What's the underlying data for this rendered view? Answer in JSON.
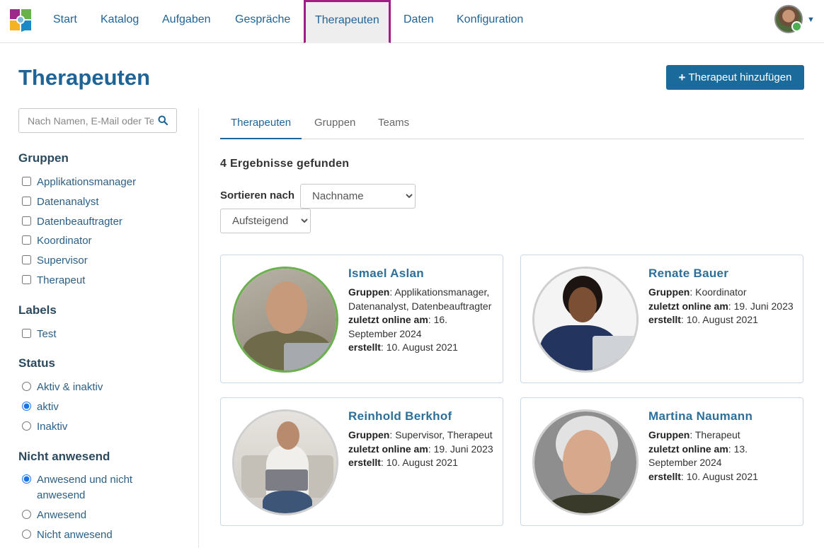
{
  "nav": {
    "items": [
      "Start",
      "Katalog",
      "Aufgaben",
      "Gespräche",
      "Therapeuten",
      "Daten",
      "Konfiguration"
    ],
    "active": "Therapeuten"
  },
  "page": {
    "title": "Therapeuten",
    "add_button": "Therapeut hinzufügen"
  },
  "sidebar": {
    "search_placeholder": "Nach Namen, E-Mail oder Te",
    "groups": {
      "heading": "Gruppen",
      "options": [
        "Applikationsmanager",
        "Datenanalyst",
        "Datenbeauftragter",
        "Koordinator",
        "Supervisor",
        "Therapeut"
      ]
    },
    "labels": {
      "heading": "Labels",
      "options": [
        "Test"
      ]
    },
    "status": {
      "heading": "Status",
      "options": [
        "Aktiv & inaktiv",
        "aktiv",
        "Inaktiv"
      ],
      "selected": "aktiv"
    },
    "absent": {
      "heading": "Nicht anwesend",
      "options": [
        "Anwesend und nicht anwesend",
        "Anwesend",
        "Nicht anwesend"
      ],
      "selected": "Anwesend und nicht anwesend"
    }
  },
  "tabs": [
    "Therapeuten",
    "Gruppen",
    "Teams"
  ],
  "results_text": "4 Ergebnisse gefunden",
  "sort": {
    "label": "Sortieren nach",
    "field": "Nachname",
    "direction": "Aufsteigend"
  },
  "field_labels": {
    "groups": "Gruppen",
    "last_online": "zuletzt online am",
    "created": "erstellt"
  },
  "therapists": [
    {
      "name": "Ismael Aslan",
      "groups": "Applikationsmanager, Datenanalyst, Datenbeauftragter",
      "last_online": "16. September 2024",
      "created": "10. August 2021",
      "online": true
    },
    {
      "name": "Renate Bauer",
      "groups": "Koordinator",
      "last_online": "19. Juni 2023",
      "created": "10. August 2021",
      "online": false
    },
    {
      "name": "Reinhold Berkhof",
      "groups": "Supervisor, Therapeut",
      "last_online": "19. Juni 2023",
      "created": "10. August 2021",
      "online": false
    },
    {
      "name": "Martina Naumann",
      "groups": "Therapeut",
      "last_online": "13. September 2024",
      "created": "10. August 2021",
      "online": false
    }
  ],
  "colors": {
    "brand": "#1f6496",
    "button": "#1a6a9b",
    "active_tab_border": "#a21d83",
    "online_ring": "#6ab04c"
  }
}
